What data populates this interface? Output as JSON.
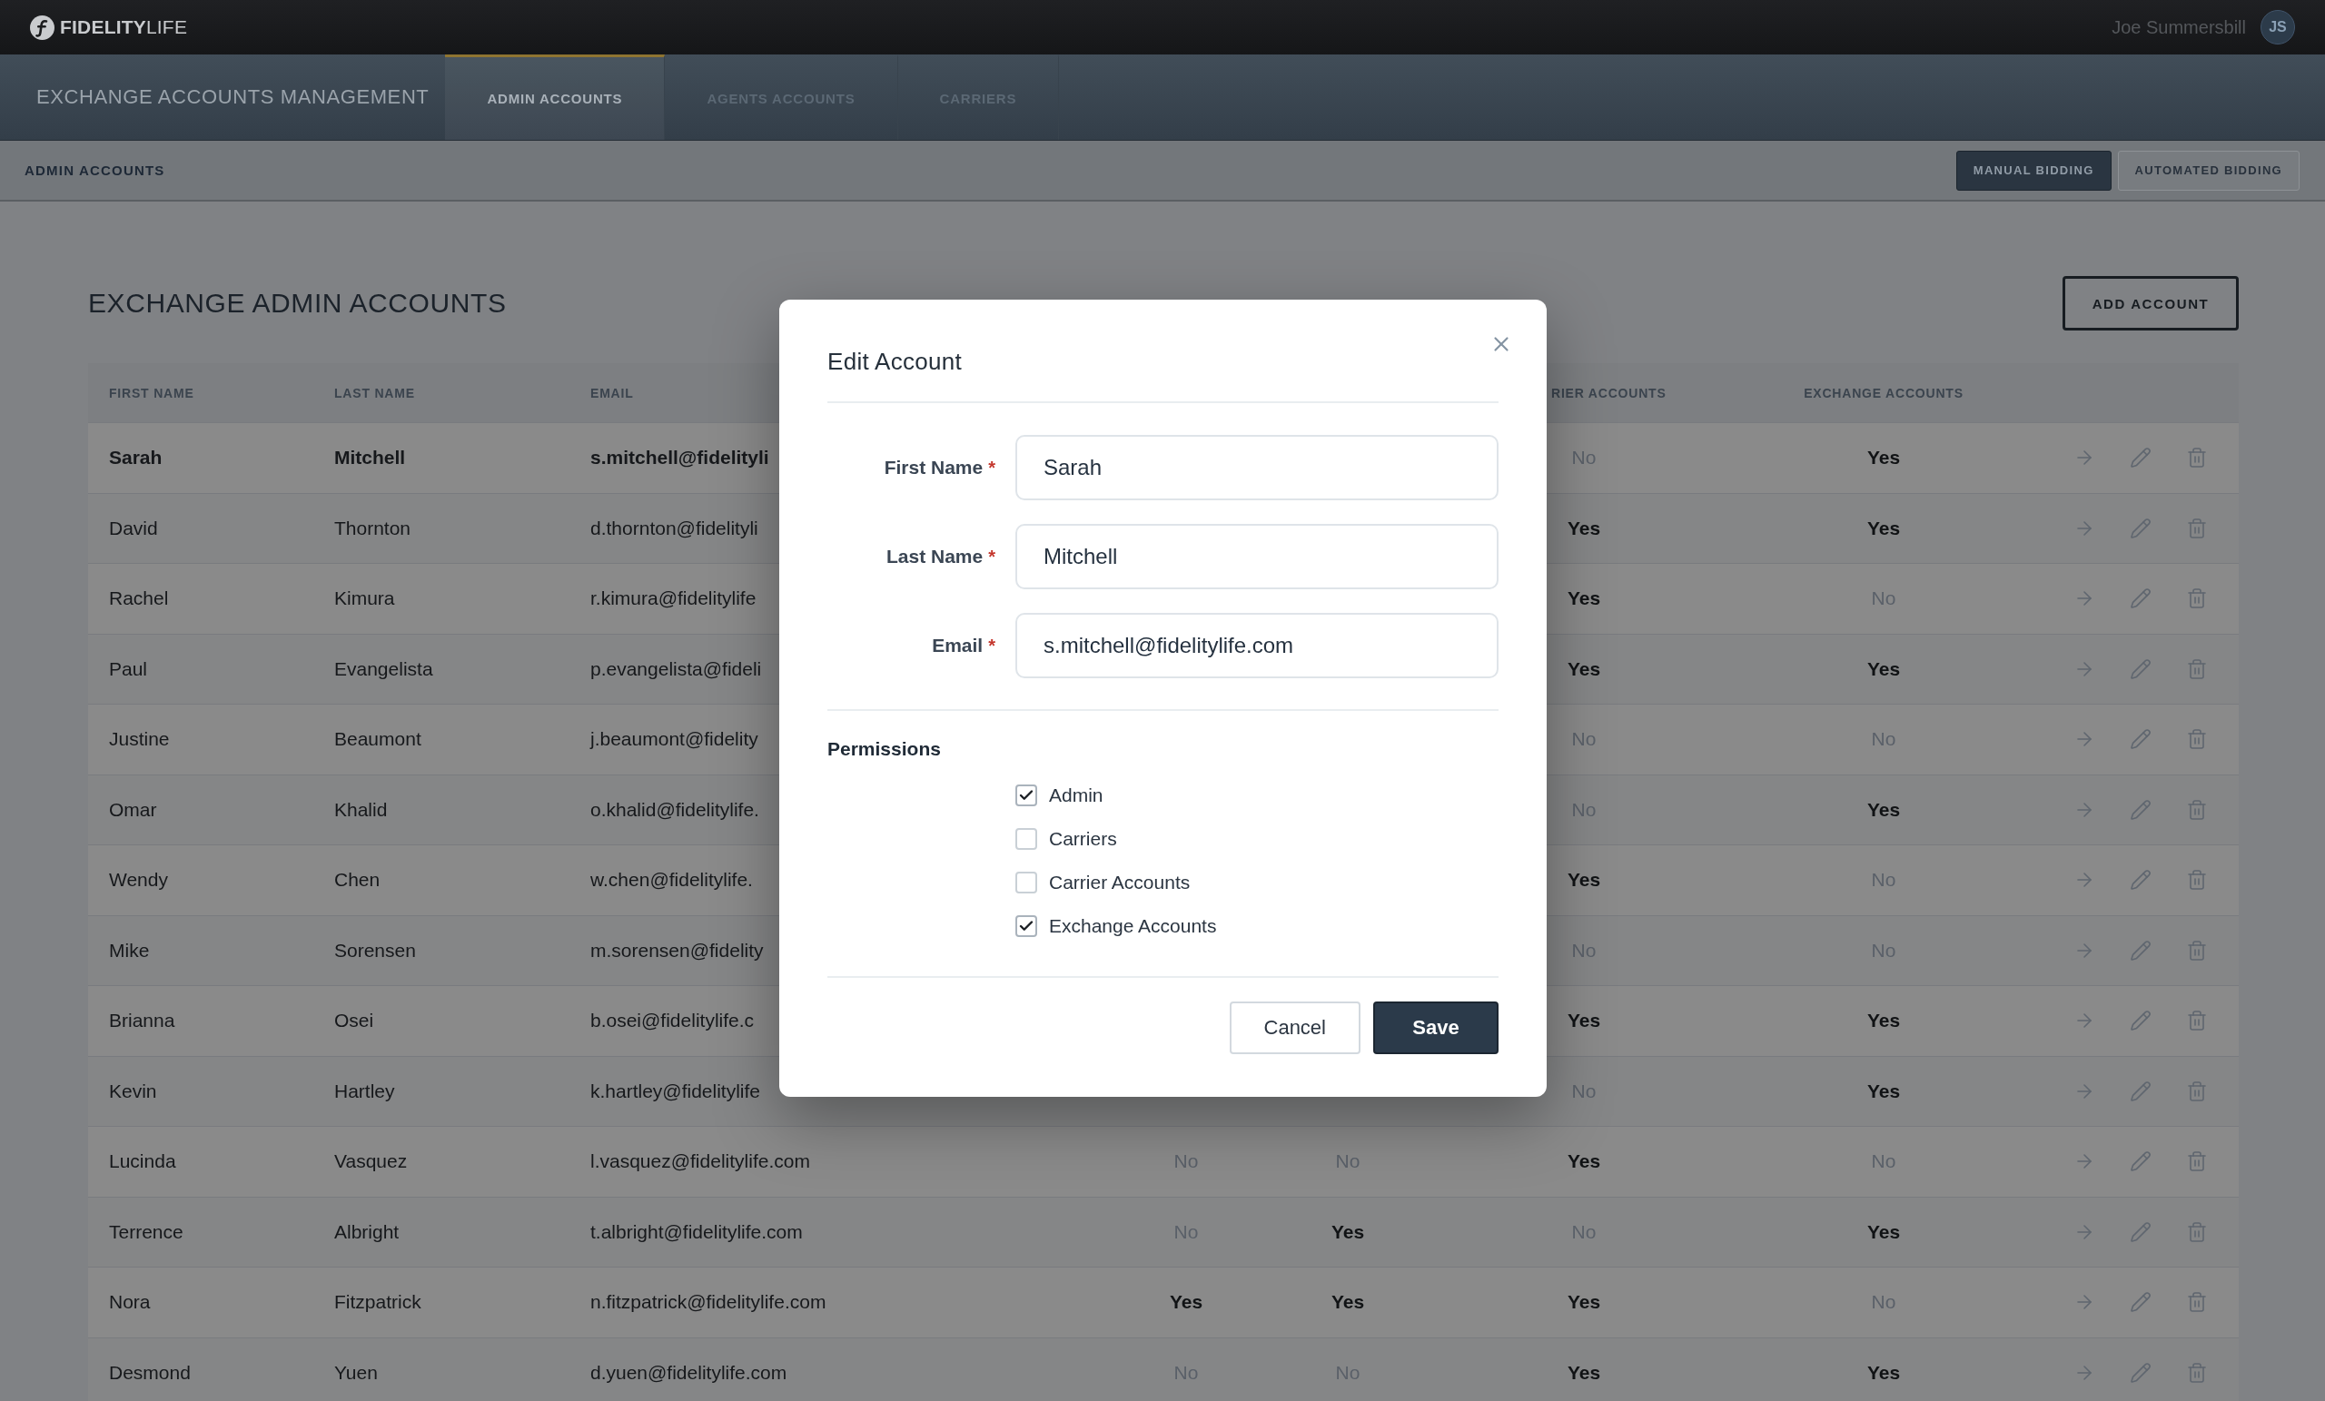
{
  "top_bar": {
    "logo": "**FIDELITY**LIFE",
    "user_name": "Joe Summersbill",
    "user_initials": "JS"
  },
  "nav": {
    "title": "EXCHANGE ACCOUNTS MANAGEMENT",
    "tabs": [
      {
        "label": "ADMIN ACCOUNTS",
        "selected": true
      },
      {
        "label": "AGENTS ACCOUNTS",
        "selected": false
      },
      {
        "label": "CARRIERS",
        "selected": false
      }
    ]
  },
  "sub_bar": {
    "label": "ADMIN ACCOUNTS",
    "modes": [
      {
        "label": "MANUAL BIDDING",
        "selected": true
      },
      {
        "label": "AUTOMATED BIDDING",
        "selected": false
      }
    ]
  },
  "page": {
    "title": "EXCHANGE ADMIN ACCOUNTS",
    "add_button": "ADD ACCOUNT"
  },
  "table": {
    "columns": {
      "first_name": "FIRST NAME",
      "last_name": "LAST NAME",
      "email": "EMAIL",
      "column_6": "RIER ACCOUNTS",
      "exchange_accounts": "EXCHANGE ACCOUNTS"
    },
    "rows": [
      {
        "selected": true,
        "first_name": "Sarah",
        "last_name": "Mitchell",
        "email": "s.mitchell@fidelityli",
        "column_6": {
          "text": "No",
          "on": false
        },
        "exchange_accounts": {
          "text": "Yes",
          "on": true
        }
      },
      {
        "selected": false,
        "first_name": "David",
        "last_name": "Thornton",
        "email": "d.thornton@fidelityli",
        "column_6": {
          "text": "Yes",
          "on": true
        },
        "exchange_accounts": {
          "text": "Yes",
          "on": true
        }
      },
      {
        "selected": false,
        "first_name": "Rachel",
        "last_name": "Kimura",
        "email": "r.kimura@fidelitylife",
        "column_6": {
          "text": "Yes",
          "on": true
        },
        "exchange_accounts": {
          "text": "No",
          "on": false
        }
      },
      {
        "selected": false,
        "first_name": "Paul",
        "last_name": "Evangelista",
        "email": "p.evangelista@fideli",
        "column_6": {
          "text": "Yes",
          "on": true
        },
        "exchange_accounts": {
          "text": "Yes",
          "on": true
        }
      },
      {
        "selected": false,
        "first_name": "Justine",
        "last_name": "Beaumont",
        "email": "j.beaumont@fidelity",
        "column_6": {
          "text": "No",
          "on": false
        },
        "exchange_accounts": {
          "text": "No",
          "on": false
        }
      },
      {
        "selected": false,
        "first_name": "Omar",
        "last_name": "Khalid",
        "email": "o.khalid@fidelitylife.",
        "column_6": {
          "text": "No",
          "on": false
        },
        "exchange_accounts": {
          "text": "Yes",
          "on": true
        }
      },
      {
        "selected": false,
        "first_name": "Wendy",
        "last_name": "Chen",
        "email": "w.chen@fidelitylife.",
        "column_6": {
          "text": "Yes",
          "on": true
        },
        "exchange_accounts": {
          "text": "No",
          "on": false
        }
      },
      {
        "selected": false,
        "first_name": "Mike",
        "last_name": "Sorensen",
        "email": "m.sorensen@fidelity",
        "column_6": {
          "text": "No",
          "on": false
        },
        "exchange_accounts": {
          "text": "No",
          "on": false
        }
      },
      {
        "selected": false,
        "first_name": "Brianna",
        "last_name": "Osei",
        "email": "b.osei@fidelitylife.c",
        "column_6": {
          "text": "Yes",
          "on": true
        },
        "exchange_accounts": {
          "text": "Yes",
          "on": true
        }
      },
      {
        "selected": false,
        "first_name": "Kevin",
        "last_name": "Hartley",
        "email": "k.hartley@fidelitylife",
        "column_6": {
          "text": "No",
          "on": false
        },
        "exchange_accounts": {
          "text": "Yes",
          "on": true
        }
      },
      {
        "selected": false,
        "first_name": "Lucinda",
        "last_name": "Vasquez",
        "email": "l.vasquez@fidelitylife.com",
        "column_4": {
          "text": "No",
          "on": false
        },
        "column_5": {
          "text": "No",
          "on": false
        },
        "column_6": {
          "text": "Yes",
          "on": true
        },
        "exchange_accounts": {
          "text": "No",
          "on": false
        }
      },
      {
        "selected": false,
        "first_name": "Terrence",
        "last_name": "Albright",
        "email": "t.albright@fidelitylife.com",
        "column_4": {
          "text": "No",
          "on": false
        },
        "column_5": {
          "text": "Yes",
          "on": true
        },
        "column_6": {
          "text": "No",
          "on": false
        },
        "exchange_accounts": {
          "text": "Yes",
          "on": true
        }
      },
      {
        "selected": false,
        "first_name": "Nora",
        "last_name": "Fitzpatrick",
        "email": "n.fitzpatrick@fidelitylife.com",
        "column_4": {
          "text": "Yes",
          "on": true
        },
        "column_5": {
          "text": "Yes",
          "on": true
        },
        "column_6": {
          "text": "Yes",
          "on": true
        },
        "exchange_accounts": {
          "text": "No",
          "on": false
        }
      },
      {
        "selected": false,
        "first_name": "Desmond",
        "last_name": "Yuen",
        "email": "d.yuen@fidelitylife.com",
        "column_4": {
          "text": "No",
          "on": false
        },
        "column_5": {
          "text": "No",
          "on": false
        },
        "column_6": {
          "text": "Yes",
          "on": true
        },
        "exchange_accounts": {
          "text": "Yes",
          "on": true
        }
      }
    ]
  },
  "modal": {
    "title": "Edit Account",
    "fields": [
      {
        "label": "First Name",
        "required_mark": "*",
        "value": "Sarah"
      },
      {
        "label": "Last Name",
        "required_mark": "*",
        "value": "Mitchell"
      },
      {
        "label": "Email",
        "required_mark": "*",
        "value": "s.mitchell@fidelitylife.com"
      }
    ],
    "permissions": {
      "title": "Permissions",
      "options": [
        {
          "label": "Admin",
          "checked": true
        },
        {
          "label": "Carriers",
          "checked": false
        },
        {
          "label": "Carrier Accounts",
          "checked": false
        },
        {
          "label": "Exchange Accounts",
          "checked": true
        }
      ]
    },
    "buttons": [
      {
        "label": "Cancel",
        "kind": "secondary"
      },
      {
        "label": "Save",
        "kind": "primary"
      }
    ]
  }
}
